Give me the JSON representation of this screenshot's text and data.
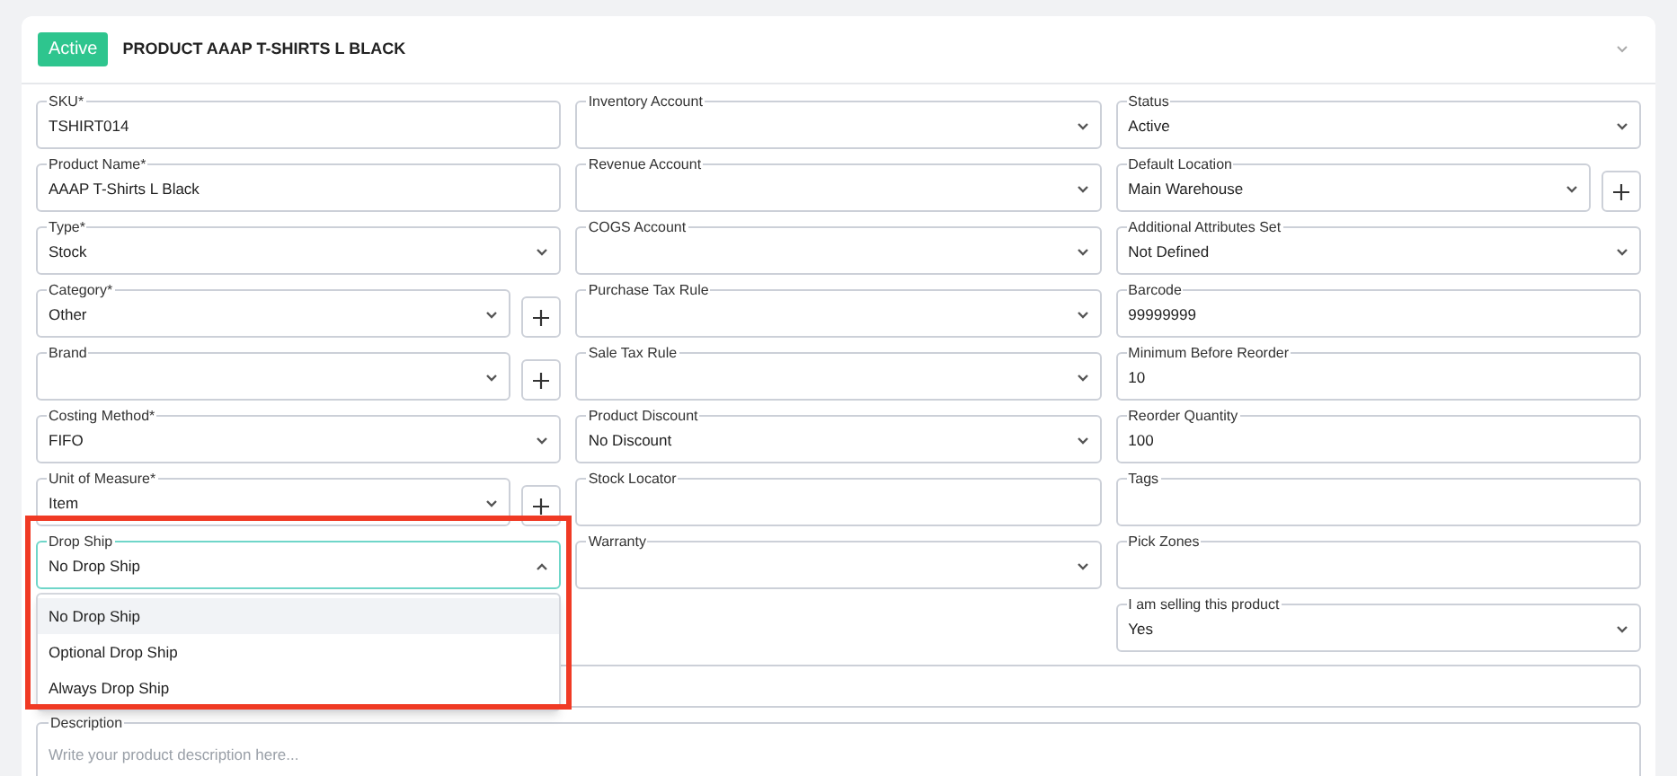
{
  "header": {
    "status_badge": "Active",
    "title": "PRODUCT AAAP T-SHIRTS L BLACK",
    "expanded": true
  },
  "columns": [
    [
      {
        "label": "SKU*",
        "kind": "text",
        "value": "TSHIRT014"
      },
      {
        "label": "Product Name*",
        "kind": "text",
        "value": "AAAP T-Shirts L Black"
      },
      {
        "label": "Type*",
        "kind": "select",
        "value": "Stock"
      },
      {
        "label": "Category*",
        "kind": "select",
        "value": "Other",
        "add": true
      },
      {
        "label": "Brand",
        "kind": "select",
        "add": true
      },
      {
        "label": "Costing Method*",
        "kind": "select",
        "value": "FIFO"
      },
      {
        "label": "Unit of Measure*",
        "kind": "select",
        "value": "Item",
        "add": true
      },
      {
        "label": "Drop Ship",
        "kind": "select",
        "value": "No Drop Ship",
        "open": true,
        "highlighted": true,
        "options": [
          {
            "label": "No Drop Ship",
            "selected": true
          },
          {
            "label": "Optional Drop Ship",
            "selected": false
          },
          {
            "label": "Always Drop Ship",
            "selected": false
          }
        ]
      }
    ],
    [
      {
        "label": "Inventory Account",
        "kind": "select"
      },
      {
        "label": "Revenue Account",
        "kind": "select"
      },
      {
        "label": "COGS Account",
        "kind": "select"
      },
      {
        "label": "Purchase Tax Rule",
        "kind": "select"
      },
      {
        "label": "Sale Tax Rule",
        "kind": "select"
      },
      {
        "label": "Product Discount",
        "kind": "select",
        "value": "No Discount"
      },
      {
        "label": "Stock Locator",
        "kind": "text"
      },
      {
        "label": "Warranty",
        "kind": "select"
      }
    ],
    [
      {
        "label": "Status",
        "kind": "select",
        "value": "Active"
      },
      {
        "label": "Default Location",
        "kind": "select",
        "value": "Main Warehouse",
        "add": true
      },
      {
        "label": "Additional Attributes Set",
        "kind": "select",
        "value": "Not Defined"
      },
      {
        "label": "Barcode",
        "kind": "text",
        "value": "99999999"
      },
      {
        "label": "Minimum Before Reorder",
        "kind": "text",
        "value": "10"
      },
      {
        "label": "Reorder Quantity",
        "kind": "text",
        "value": "100"
      },
      {
        "label": "Tags",
        "kind": "text"
      },
      {
        "label": "Pick Zones",
        "kind": "text"
      },
      {
        "label": "I am selling this product",
        "kind": "select",
        "value": "Yes"
      }
    ]
  ],
  "description": {
    "label": "Description",
    "placeholder": "Write your product description here..."
  }
}
